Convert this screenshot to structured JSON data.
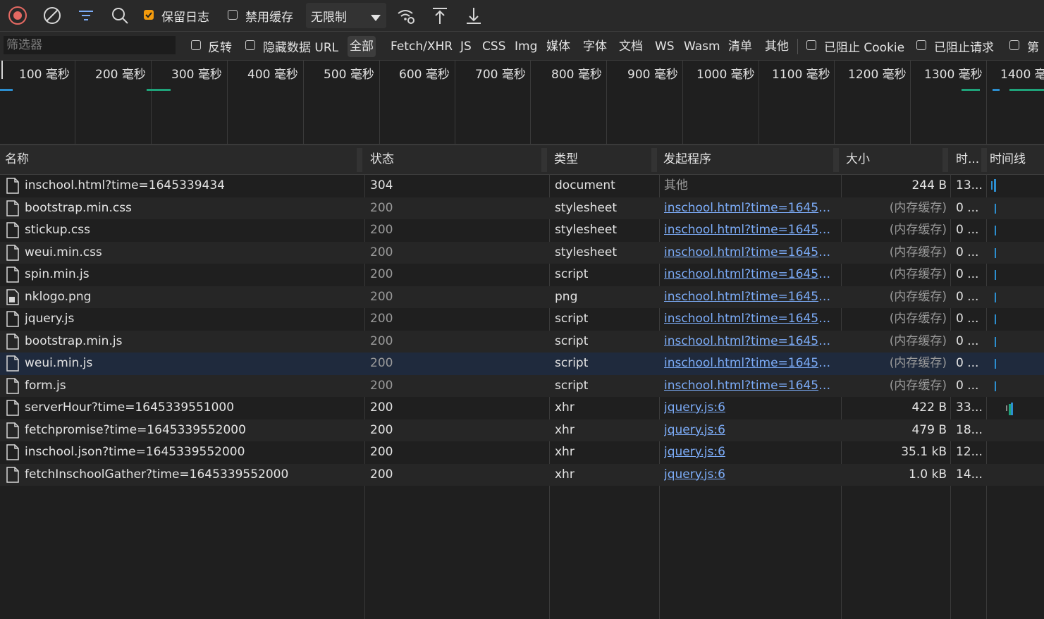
{
  "toolbar": {
    "preserve_log_label": "保留日志",
    "preserve_log_checked": true,
    "disable_cache_label": "禁用缓存",
    "disable_cache_checked": false,
    "throttle_value": "无限制",
    "icons": [
      "record-stop-icon",
      "clear-icon",
      "filter-icon",
      "search-icon",
      "wifi-gear-icon",
      "upload-icon",
      "download-icon",
      "chevron-down-icon"
    ],
    "accent_color": "#f29a0d"
  },
  "filterbar": {
    "placeholder": "筛选器",
    "invert_label": "反转",
    "hide_data_urls_label": "隐藏数据 URL",
    "types": [
      "全部",
      "Fetch/XHR",
      "JS",
      "CSS",
      "Img",
      "媒体",
      "字体",
      "文档",
      "WS",
      "Wasm",
      "清单",
      "其他"
    ],
    "active_type": "全部",
    "blocked_cookies_label": "已阻止 Cookie",
    "blocked_requests_label": "已阻止请求",
    "third_party_label": "第"
  },
  "overview": {
    "ticks": [
      "100 毫秒",
      "200 毫秒",
      "300 毫秒",
      "400 毫秒",
      "500 毫秒",
      "600 毫秒",
      "700 毫秒",
      "800 毫秒",
      "900 毫秒",
      "1000 毫秒",
      "1100 毫秒",
      "1200 毫秒",
      "1300 毫秒",
      "1400 毫"
    ]
  },
  "table": {
    "headers": {
      "name": "名称",
      "status": "状态",
      "type": "类型",
      "initiator": "发起程序",
      "size": "大小",
      "time": "时...",
      "waterfall": "时间线"
    },
    "rows": [
      {
        "name": "inschool.html?time=1645339434",
        "status": "304",
        "type": "document",
        "initiator": "其他",
        "initiator_link": false,
        "size": "244 B",
        "time": "13...",
        "icon": "document-icon"
      },
      {
        "name": "bootstrap.min.css",
        "status": "200",
        "type": "stylesheet",
        "initiator": "inschool.html?time=1645339...",
        "initiator_link": true,
        "size": "(内存缓存)",
        "time": "0 ...",
        "icon": "document-icon"
      },
      {
        "name": "stickup.css",
        "status": "200",
        "type": "stylesheet",
        "initiator": "inschool.html?time=1645339...",
        "initiator_link": true,
        "size": "(内存缓存)",
        "time": "0 ...",
        "icon": "document-icon"
      },
      {
        "name": "weui.min.css",
        "status": "200",
        "type": "stylesheet",
        "initiator": "inschool.html?time=1645339...",
        "initiator_link": true,
        "size": "(内存缓存)",
        "time": "0 ...",
        "icon": "document-icon"
      },
      {
        "name": "spin.min.js",
        "status": "200",
        "type": "script",
        "initiator": "inschool.html?time=1645339...",
        "initiator_link": true,
        "size": "(内存缓存)",
        "time": "0 ...",
        "icon": "document-icon"
      },
      {
        "name": "nklogo.png",
        "status": "200",
        "type": "png",
        "initiator": "inschool.html?time=1645339...",
        "initiator_link": true,
        "size": "(内存缓存)",
        "time": "0 ...",
        "icon": "image-file-icon"
      },
      {
        "name": "jquery.js",
        "status": "200",
        "type": "script",
        "initiator": "inschool.html?time=1645339...",
        "initiator_link": true,
        "size": "(内存缓存)",
        "time": "0 ...",
        "icon": "document-icon"
      },
      {
        "name": "bootstrap.min.js",
        "status": "200",
        "type": "script",
        "initiator": "inschool.html?time=1645339...",
        "initiator_link": true,
        "size": "(内存缓存)",
        "time": "0 ...",
        "icon": "document-icon"
      },
      {
        "name": "weui.min.js",
        "status": "200",
        "type": "script",
        "initiator": "inschool.html?time=1645339...",
        "initiator_link": true,
        "size": "(内存缓存)",
        "time": "0 ...",
        "icon": "document-icon",
        "selected": true
      },
      {
        "name": "form.js",
        "status": "200",
        "type": "script",
        "initiator": "inschool.html?time=1645339...",
        "initiator_link": true,
        "size": "(内存缓存)",
        "time": "0 ...",
        "icon": "document-icon"
      },
      {
        "name": "serverHour?time=1645339551000",
        "status": "200",
        "type": "xhr",
        "initiator": "jquery.js:6",
        "initiator_link": true,
        "size": "422 B",
        "time": "33...",
        "icon": "document-icon"
      },
      {
        "name": "fetchpromise?time=1645339552000",
        "status": "200",
        "type": "xhr",
        "initiator": "jquery.js:6",
        "initiator_link": true,
        "size": "479 B",
        "time": "18...",
        "icon": "document-icon"
      },
      {
        "name": "inschool.json?time=1645339552000",
        "status": "200",
        "type": "xhr",
        "initiator": "jquery.js:6",
        "initiator_link": true,
        "size": "35.1 kB",
        "time": "12...",
        "icon": "document-icon"
      },
      {
        "name": "fetchInschoolGather?time=1645339552000",
        "status": "200",
        "type": "xhr",
        "initiator": "jquery.js:6",
        "initiator_link": true,
        "size": "1.0 kB",
        "time": "14...",
        "icon": "document-icon"
      }
    ]
  }
}
